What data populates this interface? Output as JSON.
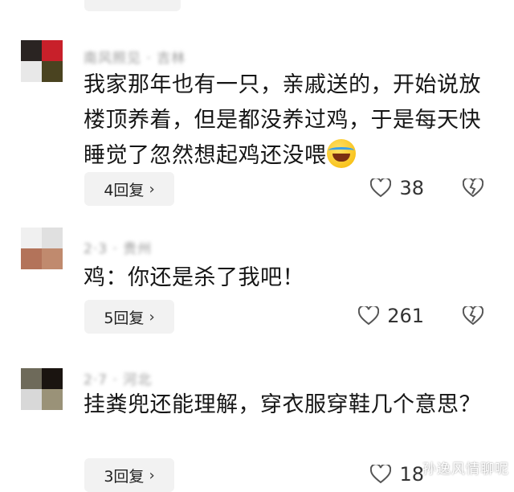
{
  "comments": [
    {
      "meta": "南风照见 · 吉林",
      "text": "我家那年也有一只，亲戚送的，开始说放楼顶养着，但是都没养过鸡，于是每天快睡觉了忽然想起鸡还没喂",
      "emoji": "rolling-laughing-emoji",
      "reply_label": "4回复",
      "like_count": "38",
      "avatar_colors": [
        "#2a2422",
        "#c8202a",
        "#e8e8e8",
        "#4a4320"
      ]
    },
    {
      "meta": "2·3 · 贵州",
      "text": "鸡：你还是杀了我吧！",
      "reply_label": "5回复",
      "like_count": "261",
      "avatar_colors": [
        "#f0f0f0",
        "#e0e0e0",
        "#b3735a",
        "#c08a6e"
      ]
    },
    {
      "meta": "2·7 · 河北",
      "text": "挂粪兜还能理解，穿衣服穿鞋几个意思？",
      "reply_label": "3回复",
      "like_count": "18",
      "avatar_colors": [
        "#6e6a5a",
        "#1a1410",
        "#d8d8d8",
        "#9a9278"
      ]
    }
  ],
  "watermark": "孙逸风情聊呢"
}
